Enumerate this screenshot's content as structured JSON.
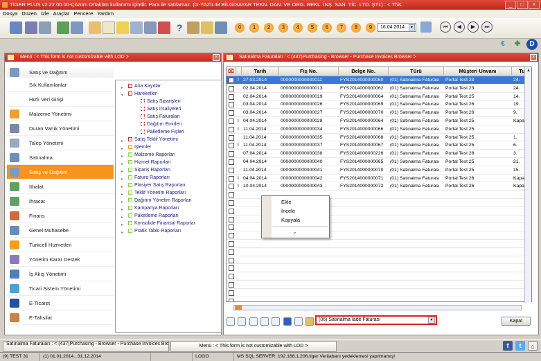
{
  "window": {
    "title": "TIGER PLUS v2.22.00.00-Çözüm Ortakları kullanımı içindir. Para ile satılamaz. (G-YAZILIM BİLGİSAYAR TEKN. DAN. VE ORG. REKL. İNŞ. SAN. TİC. LTD. ŞTİ.) : < This"
  },
  "menubar": [
    "Dosya",
    "Düzen",
    "İzle",
    "Araçlar",
    "Pencere",
    "Yardım"
  ],
  "toolbar": {
    "numbers": [
      "0",
      "1",
      "2",
      "3",
      "4",
      "5",
      "6",
      "7",
      "8",
      "9"
    ],
    "date": "16.04.2014"
  },
  "left_panel": {
    "title": "Menü : < This form is not customizable with LOD >",
    "header_item": "Satış ve Dağıtım",
    "items": [
      {
        "label": "Sık Kullanılanlar",
        "icon": "star-icon",
        "sub": true
      },
      {
        "label": "Hızlı Veri Girişi",
        "icon": "lightning-icon",
        "sub": true
      },
      {
        "label": "Malzeme Yönetimi",
        "icon": "box-icon"
      },
      {
        "label": "Duran Varlık Yönetimi",
        "icon": "building-icon"
      },
      {
        "label": "Talep Yönetimi",
        "icon": "clipboard-icon"
      },
      {
        "label": "Satınalma",
        "icon": "cart-icon"
      },
      {
        "label": "Satış ve Dağıtım",
        "icon": "truck-icon",
        "active": true
      },
      {
        "label": "İthalat",
        "icon": "import-icon"
      },
      {
        "label": "İhracat",
        "icon": "export-icon"
      },
      {
        "label": "Finans",
        "icon": "finance-icon"
      },
      {
        "label": "Genel Muhasebe",
        "icon": "ledger-icon"
      },
      {
        "label": "Turkcell Hizmetleri",
        "icon": "turkcell-icon"
      },
      {
        "label": "Yönetim Karar Destek",
        "icon": "chart-icon"
      },
      {
        "label": "İş Akış Yönetimi",
        "icon": "workflow-icon"
      },
      {
        "label": "Ticari Sistem Yönetimi",
        "icon": "globe-icon"
      },
      {
        "label": "E-Ticaret",
        "icon": "eticaret-icon"
      },
      {
        "label": "E-Tahsilat",
        "icon": "etahsilat-icon"
      }
    ]
  },
  "tree": [
    {
      "label": "Ana Kayıtlar",
      "level": 0,
      "exp": "+",
      "color": "red"
    },
    {
      "label": "Hareketler",
      "level": 0,
      "exp": "-",
      "color": "red"
    },
    {
      "label": "Satış Siparişleri",
      "level": 1,
      "color": "redgrid"
    },
    {
      "label": "Satış İrsaliyeleri",
      "level": 1,
      "color": "redgrid"
    },
    {
      "label": "Satış Faturaları",
      "level": 1,
      "color": "redgrid"
    },
    {
      "label": "Dağıtım Emirleri",
      "level": 1,
      "color": "redgrid"
    },
    {
      "label": "Paketleme Fişleri",
      "level": 1,
      "color": "redgrid"
    },
    {
      "label": "Satış Teklif Yönetimi",
      "level": 0,
      "exp": "+",
      "color": "red"
    },
    {
      "label": "İşlemler",
      "level": 0,
      "exp": "+",
      "color": "orange"
    },
    {
      "label": "Malzeme Raporları",
      "level": 0,
      "exp": "+",
      "color": "green"
    },
    {
      "label": "Hizmet Raporları",
      "level": 0,
      "exp": "+",
      "color": "green"
    },
    {
      "label": "Sipariş Raporları",
      "level": 0,
      "exp": "+",
      "color": "green"
    },
    {
      "label": "Fatura Raporları",
      "level": 0,
      "exp": "+",
      "color": "green"
    },
    {
      "label": "Plasiyer Satış Raporları",
      "level": 0,
      "exp": "+",
      "color": "green"
    },
    {
      "label": "Teklif Yönetim Raporları",
      "level": 0,
      "exp": "+",
      "color": "green"
    },
    {
      "label": "Dağıtım Yönetim Raporları",
      "level": 0,
      "exp": "+",
      "color": "green"
    },
    {
      "label": "Kampanya Raporları",
      "level": 0,
      "exp": "+",
      "color": "green"
    },
    {
      "label": "Paketleme Raporları",
      "level": 0,
      "exp": "+",
      "color": "green"
    },
    {
      "label": "Konsolide Finansal Raporlar",
      "level": 0,
      "exp": "+",
      "color": "green"
    },
    {
      "label": "Pratik Tablo Raporları",
      "level": 0,
      "exp": "+",
      "color": "green"
    }
  ],
  "right_panel": {
    "title": "Satınalma Faturaları : < (437)Purchasing - Browser - Purchase Invoices Browser >",
    "columns": [
      "Tarih",
      "Fiş No.",
      "Belge No.",
      "Türü",
      "Müşteri Unvanı",
      "Tu"
    ],
    "rows": [
      {
        "flag": "I",
        "tarih": "27.03.2014",
        "fis": "0000000000000011",
        "belge": "FYS2014000000060",
        "turu": "(01) Satınalma Faturası",
        "musteri": "Portal Test 23",
        "tu": "24.",
        "sel": true
      },
      {
        "flag": "",
        "tarih": "02.04.2014",
        "fis": "0000000000000013",
        "belge": "FYS2014000000062",
        "turu": "(01) Satınalma Faturası",
        "musteri": "Portal Test 23",
        "tu": "24."
      },
      {
        "flag": "",
        "tarih": "02.04.2014",
        "fis": "0000000000000019",
        "belge": "FYS2014000000064",
        "turu": "(01) Satınalma Faturası",
        "musteri": "Portal Test 25",
        "tu": "14."
      },
      {
        "flag": "",
        "tarih": "03.04.2014",
        "fis": "0000000000000026",
        "belge": "FYS2014000000069",
        "turu": "(01) Satınalma Faturası",
        "musteri": "Portal Test 26",
        "tu": "19."
      },
      {
        "flag": "",
        "tarih": "03.04.2014",
        "fis": "0000000000000027",
        "belge": "FYS2014000000070",
        "turu": "(01) Satınalma Faturası",
        "musteri": "Portal Test 26",
        "tu": "9."
      },
      {
        "flag": "I",
        "tarih": "04.04.2014",
        "fis": "0000000000000028",
        "belge": "FYS2014000000064",
        "turu": "(01) Satınalma Faturası",
        "musteri": "Portal Test 25",
        "tu": "Kapat"
      },
      {
        "flag": "I",
        "tarih": "11.04.2014",
        "fis": "0000000000000034",
        "belge": "FYS2014000000066",
        "turu": "(01) Satınalma Faturası",
        "musteri": "Portal Test 25",
        "tu": ""
      },
      {
        "flag": "",
        "tarih": "11.04.2014",
        "fis": "0000000000000035",
        "belge": "FYS2014000000068",
        "turu": "(01) Satınalma Faturası",
        "musteri": "Portal Test 25",
        "tu": "1."
      },
      {
        "flag": "I",
        "tarih": "11.04.2014",
        "fis": "0000000000000037",
        "belge": "FYS2014000000067",
        "turu": "(01) Satınalma Faturası",
        "musteri": "Portal Test 25",
        "tu": "6."
      },
      {
        "flag": "",
        "tarih": "07.04.2014",
        "fis": "0000000000000038",
        "belge": "FYS2014000000226",
        "turu": "(01) Satınalma Faturası",
        "musteri": "Portal Test 28",
        "tu": "3."
      },
      {
        "flag": "",
        "tarih": "04.04.2014",
        "fis": "0000000000000040",
        "belge": "FYS2014000000065",
        "turu": "(01) Satınalma Faturası",
        "musteri": "Portal Test 25",
        "tu": "21."
      },
      {
        "flag": "",
        "tarih": "11.04.2014",
        "fis": "0000000000000041",
        "belge": "FYS2014000000070",
        "turu": "(01) Satınalma Faturası",
        "musteri": "Portal Test 25",
        "tu": "15."
      },
      {
        "flag": "I",
        "tarih": "04.04.2014",
        "fis": "0000000000000042",
        "belge": "FYS2014000000071",
        "turu": "(01) Satınalma Faturası",
        "musteri": "Portal Test 26",
        "tu": "Kapat"
      },
      {
        "flag": "I",
        "tarih": "10.04.2014",
        "fis": "0000000000000043",
        "belge": "FYS2014000000072",
        "turu": "(01) Satınalma Faturası",
        "musteri": "Portal Test 26",
        "tu": "Kapat"
      }
    ],
    "context_menu": [
      "Ekle",
      "İncele",
      "Kopyala"
    ],
    "type_select": "(06) Satınalma İade Faturası",
    "close_label": "Kapat"
  },
  "taskbar": {
    "tab1": "Satınalma Faturaları : < (437)Purchasing - Browser - Purchase Invoices Browser >",
    "tab2": "Menü : < This form is not customizable with LOD >"
  },
  "statusbar": {
    "company": "(9) TEST 31",
    "period": "(1) 01.01.2014...31.12.2014",
    "logo": "LOGO",
    "server": "MS SQL SERVER: 192.168.1.206.tiger Veritabanı yedeklemesi yapılmamış!"
  }
}
